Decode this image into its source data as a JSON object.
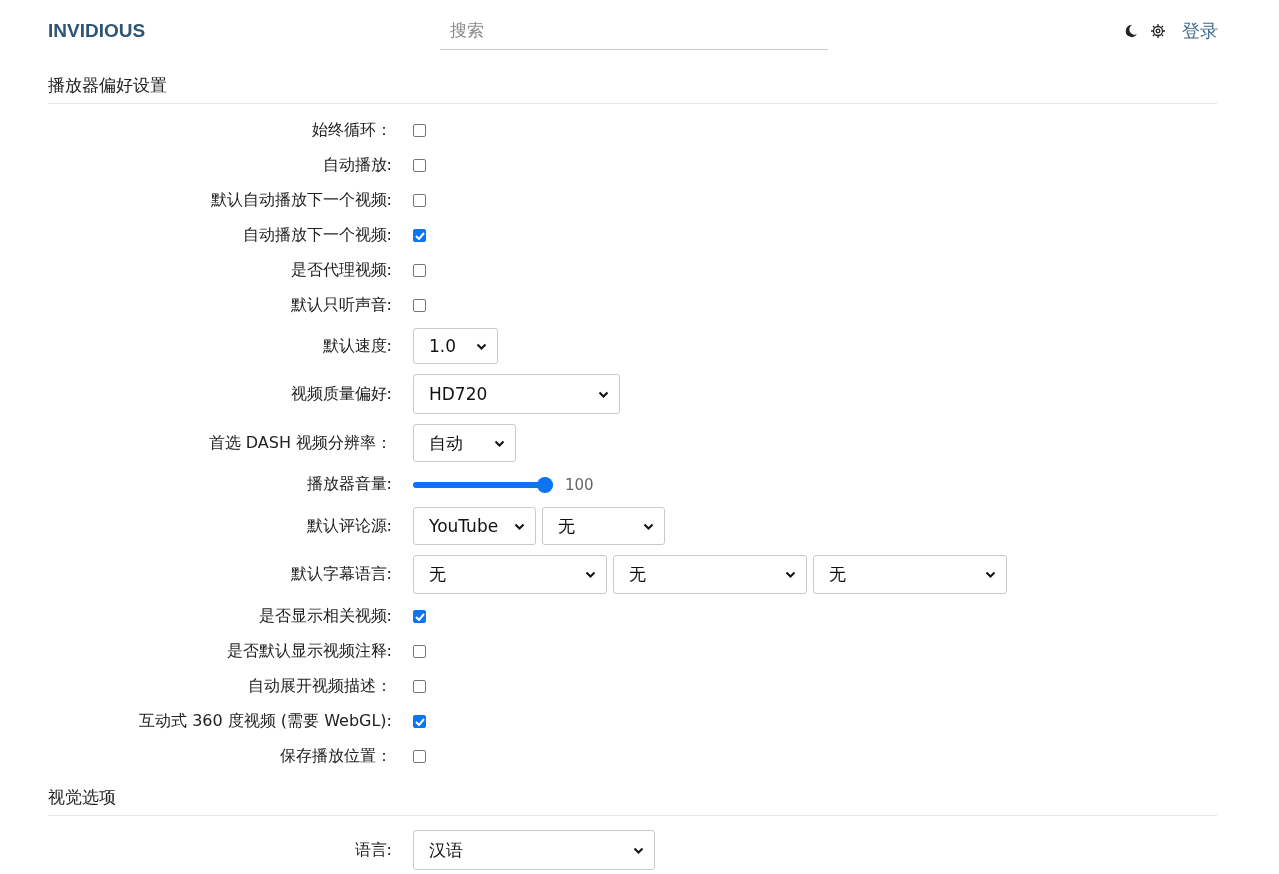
{
  "header": {
    "logo": "INVIDIOUS",
    "search": {
      "placeholder": "搜索"
    },
    "login": "登录"
  },
  "sections": [
    {
      "title": "播放器偏好设置",
      "rows": [
        {
          "kind": "checkbox",
          "label": "始终循环：",
          "checked": false
        },
        {
          "kind": "checkbox",
          "label": "自动播放:",
          "checked": false
        },
        {
          "kind": "checkbox",
          "label": "默认自动播放下一个视频:",
          "checked": false
        },
        {
          "kind": "checkbox",
          "label": "自动播放下一个视频:",
          "checked": true
        },
        {
          "kind": "checkbox",
          "label": "是否代理视频:",
          "checked": false
        },
        {
          "kind": "checkbox",
          "label": "默认只听声音:",
          "checked": false
        },
        {
          "kind": "select",
          "label": "默认速度:",
          "values": [
            "1.0"
          ]
        },
        {
          "kind": "select",
          "label": "视频质量偏好:",
          "values": [
            "HD720"
          ]
        },
        {
          "kind": "select",
          "label": "首选 DASH 视频分辨率：",
          "values": [
            "自动"
          ]
        },
        {
          "kind": "slider",
          "label": "播放器音量:",
          "level": 1,
          "reading": "100"
        },
        {
          "kind": "select",
          "label": "默认评论源:",
          "values": [
            "YouTube",
            "无"
          ]
        },
        {
          "kind": "select",
          "label": "默认字幕语言:",
          "values": [
            "无",
            "无",
            "无"
          ]
        },
        {
          "kind": "checkbox",
          "label": "是否显示相关视频:",
          "checked": true
        },
        {
          "kind": "checkbox",
          "label": "是否默认显示视频注释:",
          "checked": false
        },
        {
          "kind": "checkbox",
          "label": "自动展开视频描述：",
          "checked": false
        },
        {
          "kind": "checkbox",
          "label": "互动式 360 度视频 (需要 WebGL):",
          "checked": true
        },
        {
          "kind": "checkbox",
          "label": "保存播放位置：",
          "checked": false
        }
      ]
    },
    {
      "title": "视觉选项",
      "rows": [
        {
          "kind": "select",
          "label": "语言:",
          "values": [
            "汉语"
          ]
        }
      ]
    }
  ]
}
